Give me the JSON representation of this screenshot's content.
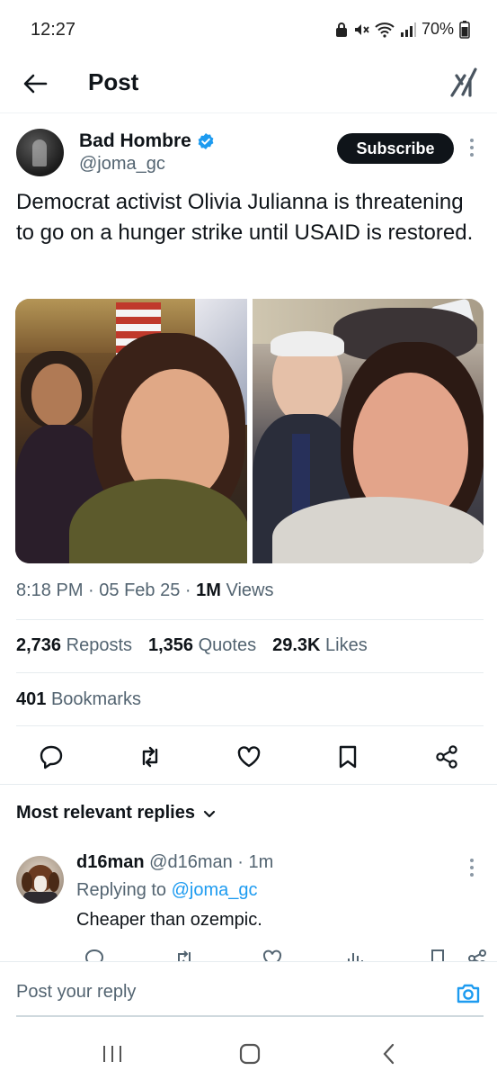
{
  "status": {
    "time": "12:27",
    "battery": "70%",
    "icons": [
      "lock-icon",
      "mute-icon",
      "wifi-icon",
      "signal-icon",
      "battery-icon"
    ]
  },
  "header": {
    "title": "Post",
    "back_icon": "arrow-left-icon",
    "grok_icon": "grok-icon"
  },
  "post": {
    "author": {
      "name": "Bad Hombre",
      "handle": "@joma_gc",
      "verified": true
    },
    "subscribe_label": "Subscribe",
    "text": "Democrat activist Olivia Julianna is threatening to go on a hunger strike until USAID is restored.",
    "meta": {
      "time": "8:18 PM",
      "date": "05 Feb 25",
      "views_count": "1M",
      "views_label": "Views"
    },
    "stats": {
      "reposts_count": "2,736",
      "reposts_label": "Reposts",
      "quotes_count": "1,356",
      "quotes_label": "Quotes",
      "likes_count": "29.3K",
      "likes_label": "Likes",
      "bookmarks_count": "401",
      "bookmarks_label": "Bookmarks"
    },
    "actions": [
      "reply-icon",
      "repost-icon",
      "like-icon",
      "bookmark-icon",
      "share-icon"
    ]
  },
  "replies": {
    "sort_label": "Most relevant replies",
    "items": [
      {
        "name": "d16man",
        "handle": "@d16man",
        "time": "1m",
        "replying_prefix": "Replying to",
        "replying_to": "@joma_gc",
        "text": "Cheaper than ozempic."
      }
    ]
  },
  "compose": {
    "placeholder": "Post your reply"
  },
  "colors": {
    "text": "#0f1419",
    "secondary": "#536471",
    "accent": "#1d9bf0",
    "button_dark": "#0f1419"
  }
}
